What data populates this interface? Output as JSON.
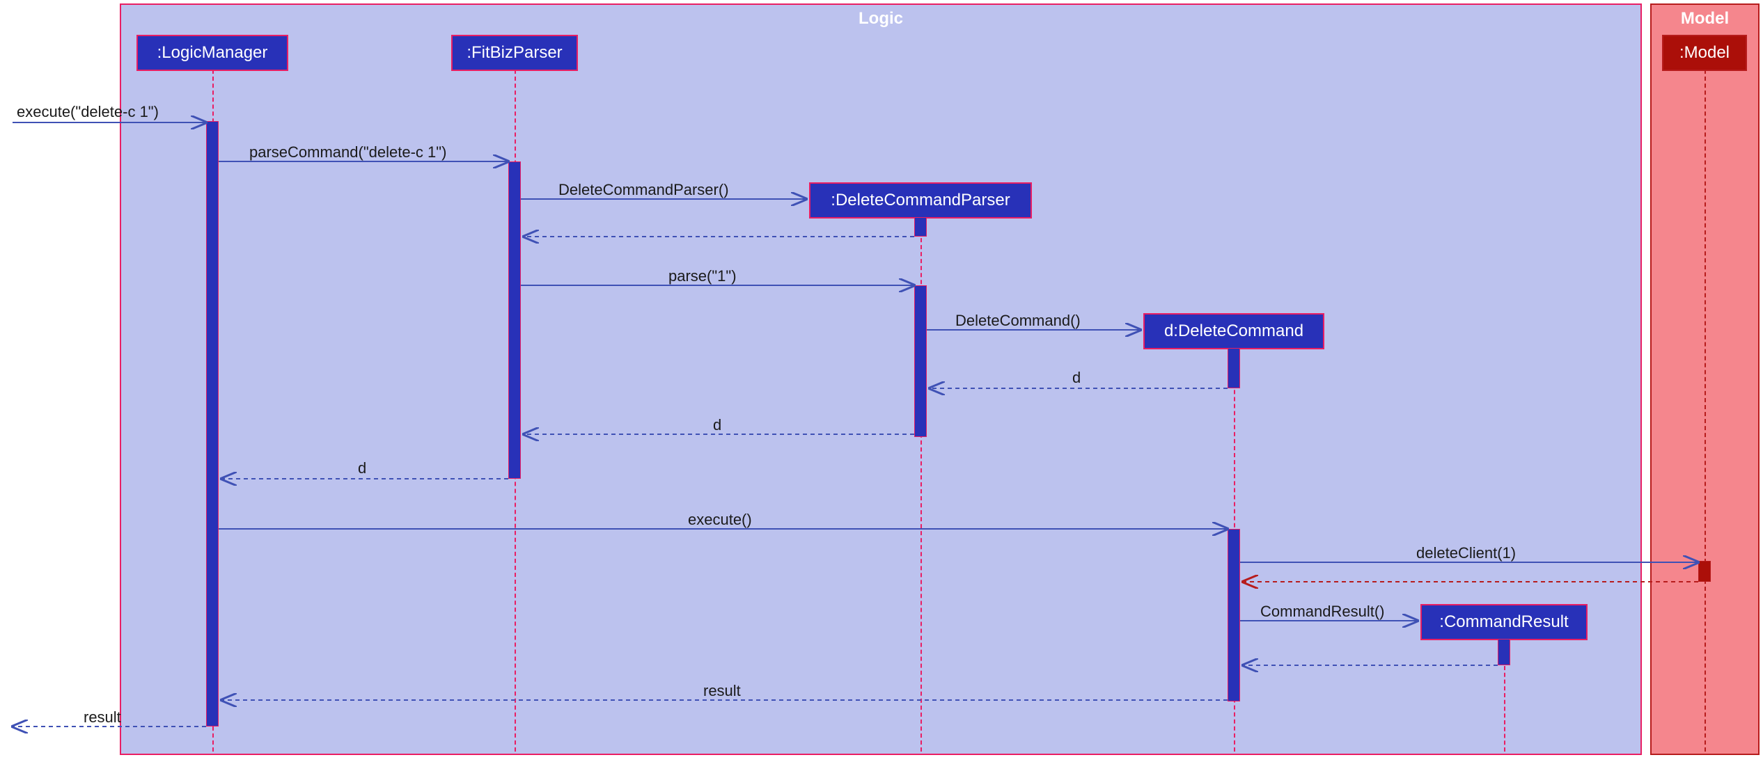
{
  "frames": {
    "logic": "Logic",
    "model": "Model"
  },
  "lifelines": {
    "logicManager": ":LogicManager",
    "fitBizParser": ":FitBizParser",
    "deleteCommandParser": ":DeleteCommandParser",
    "deleteCommand": "d:DeleteCommand",
    "commandResult": ":CommandResult",
    "model": ":Model"
  },
  "messages": {
    "executeIn": "execute(\"delete-c 1\")",
    "parseCommand": "parseCommand(\"delete-c 1\")",
    "deleteCommandParserCtor": "DeleteCommandParser()",
    "parse": "parse(\"1\")",
    "deleteCommandCtor": "DeleteCommand()",
    "d1": "d",
    "d2": "d",
    "d3": "d",
    "execute": "execute()",
    "deleteClient": "deleteClient(1)",
    "commandResultCtor": "CommandResult()",
    "result1": "result",
    "result2": "result"
  },
  "colors": {
    "logicBg": "#bcc2ee",
    "modelBg": "#f5868d",
    "blueBox": "#2831b8",
    "redBox": "#ab0f09",
    "pinkBorder": "#e91e63",
    "darkRedBorder": "#b71c1c",
    "blueLine": "#3f51b5",
    "redLine": "#b71c1c"
  }
}
